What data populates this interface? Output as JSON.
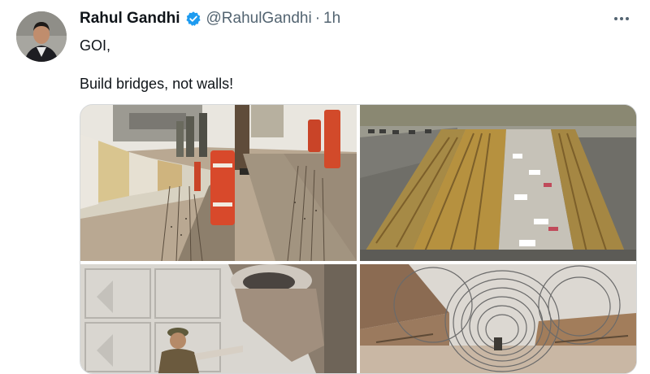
{
  "tweet": {
    "author_name": "Rahul Gandhi",
    "handle": "@RahulGandhi",
    "separator": "·",
    "timestamp": "1h",
    "text_line1": "GOI,",
    "text_line2": "Build bridges, not walls!"
  },
  "icons": {
    "verified": "verified-badge-icon",
    "more": "more-options-icon"
  },
  "colors": {
    "verified_blue": "#1d9bf0",
    "secondary_text": "#536471",
    "primary_text": "#0f1419"
  }
}
